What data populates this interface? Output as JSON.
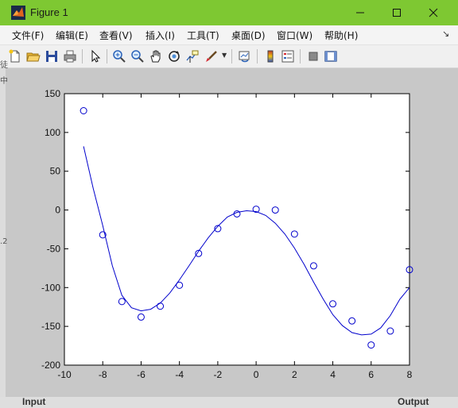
{
  "window": {
    "title": "Figure 1",
    "controls": {
      "minimize": "minimize",
      "maximize": "maximize",
      "close": "close"
    }
  },
  "menubar": {
    "items": [
      "文件(F)",
      "编辑(E)",
      "查看(V)",
      "插入(I)",
      "工具(T)",
      "桌面(D)",
      "窗口(W)",
      "帮助(H)"
    ],
    "corner": "↘"
  },
  "toolbar": {
    "buttons": [
      {
        "name": "new-figure",
        "icon": "new-document-icon"
      },
      {
        "name": "open-file",
        "icon": "folder-open-icon"
      },
      {
        "name": "save-figure",
        "icon": "floppy-disk-icon"
      },
      {
        "name": "print-figure",
        "icon": "printer-icon"
      },
      {
        "name": "edit-plot",
        "icon": "arrow-cursor-icon"
      },
      {
        "name": "zoom-in",
        "icon": "zoom-in-icon"
      },
      {
        "name": "zoom-out",
        "icon": "zoom-out-icon"
      },
      {
        "name": "pan",
        "icon": "hand-icon"
      },
      {
        "name": "rotate-3d",
        "icon": "rotate-icon"
      },
      {
        "name": "data-cursor",
        "icon": "data-cursor-icon"
      },
      {
        "name": "brush",
        "icon": "brush-icon"
      },
      {
        "name": "link-plot",
        "icon": "link-icon"
      },
      {
        "name": "insert-colorbar",
        "icon": "colorbar-icon"
      },
      {
        "name": "insert-legend",
        "icon": "legend-icon"
      },
      {
        "name": "hide-plot-tools",
        "icon": "hide-tools-icon"
      },
      {
        "name": "show-plot-tools",
        "icon": "show-tools-icon"
      }
    ]
  },
  "background_fragments": {
    "left_a": "徒",
    "left_b": "中",
    "left_c": ".2",
    "bottom_left": "Input",
    "bottom_right": "Output"
  },
  "colors": {
    "titlebar": "#7ec832",
    "plot": "#0000cc",
    "figure_bg": "#c8c8c8",
    "axes_bg": "#ffffff"
  },
  "chart_data": {
    "type": "scatter",
    "title": "",
    "xlabel": "",
    "ylabel": "",
    "xlim": [
      -10,
      8
    ],
    "ylim": [
      -200,
      150
    ],
    "xticks": [
      -10,
      -8,
      -6,
      -4,
      -2,
      0,
      2,
      4,
      6,
      8
    ],
    "yticks": [
      150,
      100,
      50,
      0,
      -50,
      -100,
      -150,
      -200
    ],
    "grid": false,
    "series": [
      {
        "kind": "markers",
        "marker": "circle",
        "color": "#0000cc",
        "x": [
          -9,
          -8,
          -7,
          -6,
          -5,
          -4,
          -3,
          -2,
          -1,
          0,
          1,
          2,
          3,
          4,
          5,
          6,
          7,
          8
        ],
        "y": [
          128,
          -32,
          -118,
          -138,
          -124,
          -97,
          -56,
          -24,
          -5,
          1,
          0,
          -31,
          -72,
          -121,
          -143,
          -174,
          -156,
          -77
        ]
      },
      {
        "kind": "line",
        "color": "#0000cc",
        "x": [
          -9,
          -8.5,
          -8,
          -7.5,
          -7,
          -6.5,
          -6,
          -5.5,
          -5,
          -4.5,
          -4,
          -3.5,
          -3,
          -2.5,
          -2,
          -1.5,
          -1,
          -0.5,
          0,
          0.5,
          1,
          1.5,
          2,
          2.5,
          3,
          3.5,
          4,
          4.5,
          5,
          5.5,
          6,
          6.5,
          7,
          7.5,
          8
        ],
        "y": [
          82,
          28,
          -20,
          -72,
          -110,
          -126,
          -130,
          -128,
          -120,
          -107,
          -90,
          -72,
          -53,
          -36,
          -21,
          -9,
          -3,
          -1,
          -2,
          -7,
          -17,
          -31,
          -49,
          -70,
          -93,
          -115,
          -135,
          -149,
          -158,
          -161,
          -160,
          -152,
          -136,
          -115,
          -100
        ]
      }
    ]
  }
}
